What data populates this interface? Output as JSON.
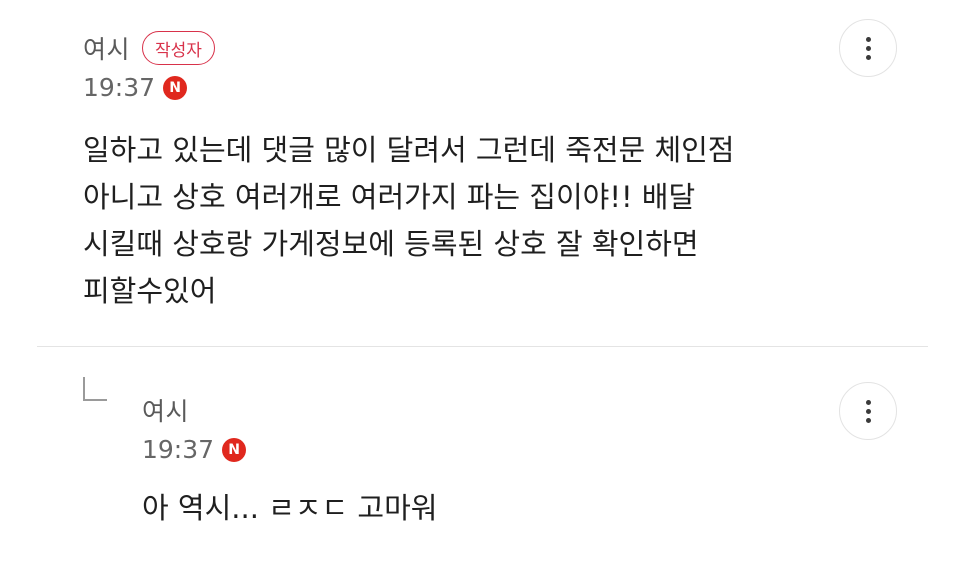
{
  "comments": [
    {
      "author": "여시",
      "badge": "작성자",
      "time": "19:37",
      "new_badge": "N",
      "text": "일하고 있는데 댓글 많이 달려서 그런데 죽전문 체인점\n아니고 상호 여러개로 여러가지 파는 집이야!! 배달\n시킬때 상호랑 가게정보에 등록된 상호 잘 확인하면\n피할수있어"
    },
    {
      "author": "여시",
      "time": "19:37",
      "new_badge": "N",
      "text": "아 역시... ㄹㅈㄷ 고마워"
    }
  ],
  "colors": {
    "accent": "#d8324a",
    "new_badge": "#e0281e",
    "divider": "#e4e4e4"
  },
  "icons": {
    "more": "more-vertical-icon",
    "reply": "reply-arrow-icon",
    "new": "new-badge-icon"
  }
}
